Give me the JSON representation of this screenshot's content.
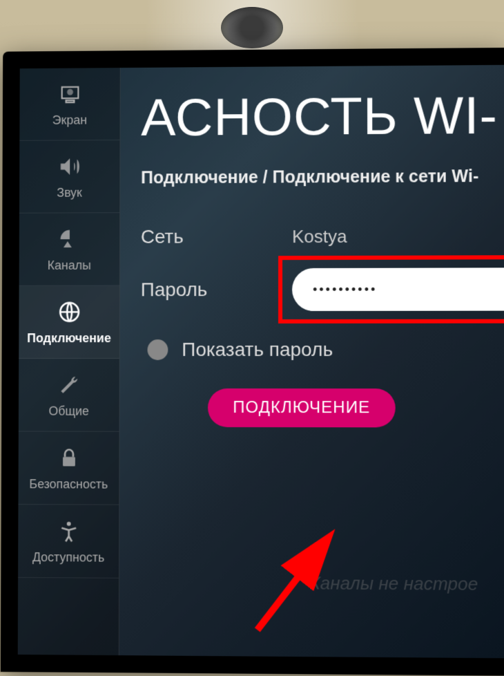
{
  "sidebar": {
    "items": [
      {
        "label": "Экран"
      },
      {
        "label": "Звук"
      },
      {
        "label": "Каналы"
      },
      {
        "label": "Подключение"
      },
      {
        "label": "Общие"
      },
      {
        "label": "Безопасность"
      },
      {
        "label": "Доступность"
      }
    ]
  },
  "main": {
    "title": "АСНОСТЬ WI-",
    "breadcrumb": "Подключение / Подключение к сети Wi-",
    "network_label": "Сеть",
    "network_value": "Kostya",
    "password_label": "Пароль",
    "password_value": "••••••••••",
    "show_password_label": "Показать пароль",
    "connect_button": "ПОДКЛЮЧЕНИЕ",
    "bottom_hint": "Каналы не настрое"
  },
  "colors": {
    "accent": "#d6006c",
    "highlight": "#ff0000"
  }
}
